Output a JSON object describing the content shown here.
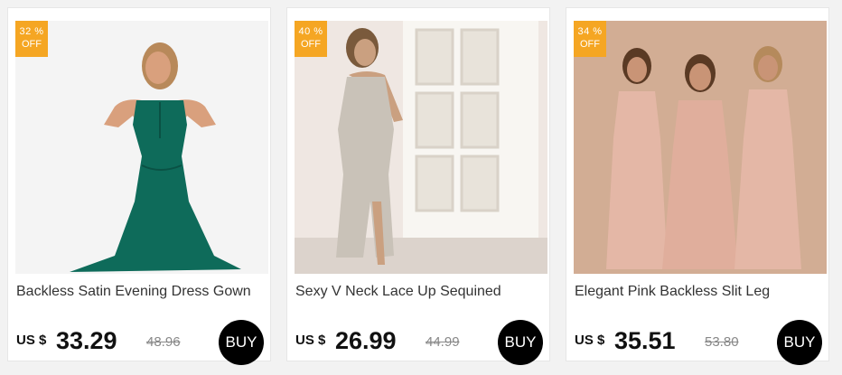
{
  "products": [
    {
      "discount_pct": "32 %",
      "discount_off": "OFF",
      "title": "Backless Satin Evening Dress Gown",
      "currency": "US $",
      "price": "33.29",
      "old_price": "48.96",
      "buy_label": "BUY",
      "image_colors": {
        "background": "#f4f4f4",
        "dress": "#0e6b5a",
        "skin": "#d9a07d",
        "hair": "#b8895a"
      }
    },
    {
      "discount_pct": "40 %",
      "discount_off": "OFF",
      "title": "Sexy V Neck Lace Up Sequined",
      "currency": "US $",
      "price": "26.99",
      "old_price": "44.99",
      "buy_label": "BUY",
      "image_colors": {
        "background": "#efe7e2",
        "dress": "#c9c2b8",
        "skin": "#caa080",
        "hair": "#7a5a3c"
      }
    },
    {
      "discount_pct": "34 %",
      "discount_off": "OFF",
      "title": "Elegant Pink Backless Slit Leg",
      "currency": "US $",
      "price": "35.51",
      "old_price": "53.80",
      "buy_label": "BUY",
      "image_colors": {
        "background": "#d8b39a",
        "dress": "#e4b7a6",
        "skin": "#c99476",
        "hair": "#5a3a24"
      }
    }
  ],
  "colors": {
    "badge": "#f5a623",
    "buy_button": "#000000",
    "old_price": "#888888"
  }
}
